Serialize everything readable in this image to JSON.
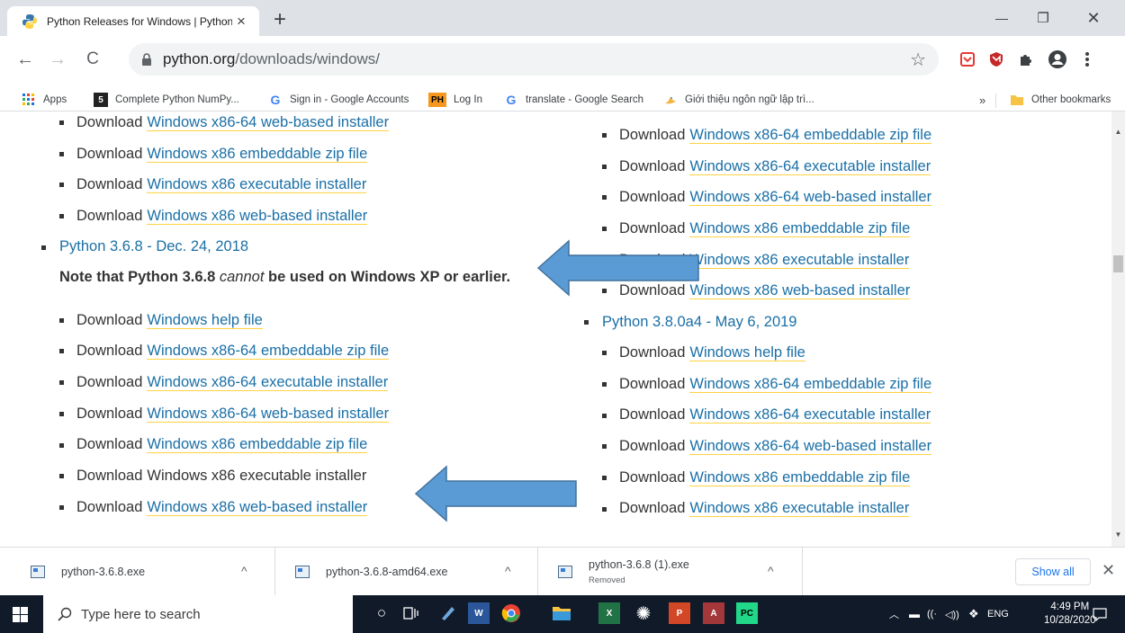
{
  "tab": {
    "title": "Python Releases for Windows | Python.org",
    "close": "×",
    "new_tab": "+"
  },
  "window": {
    "minimize": "—",
    "restore": "❐",
    "close": "✕"
  },
  "toolbar": {
    "back": "←",
    "forward": "→",
    "reload": "C",
    "url_host": "python.org",
    "url_path": "/downloads/windows/",
    "star": "☆"
  },
  "bookmarks": {
    "items": [
      {
        "label": "Apps",
        "icon": "apps-grid-icon"
      },
      {
        "label": "Complete Python NumPy...",
        "icon": "html5-icon"
      },
      {
        "label": "Sign in - Google Accounts",
        "icon": "google-icon"
      },
      {
        "label": "Log In",
        "icon": "ph-icon"
      },
      {
        "label": "translate - Google Search",
        "icon": "google-icon"
      },
      {
        "label": "Giới thiệu ngôn ngữ lập trì...",
        "icon": "bird-icon"
      }
    ],
    "overflow": "»",
    "other": "Other bookmarks"
  },
  "left": {
    "top_items": [
      {
        "prefix": "Download",
        "link": "Windows x86-64 web-based installer"
      },
      {
        "prefix": "Download",
        "link": "Windows x86 embeddable zip file"
      },
      {
        "prefix": "Download",
        "link": "Windows x86 executable installer"
      },
      {
        "prefix": "Download",
        "link": "Windows x86 web-based installer"
      }
    ],
    "release": "Python 3.6.8 - Dec. 24, 2018",
    "note_a": "Note that Python 3.6.8",
    "note_em": "cannot",
    "note_b": "be used on Windows XP or earlier.",
    "items": [
      {
        "prefix": "Download",
        "link": "Windows help file"
      },
      {
        "prefix": "Download",
        "link": "Windows x86-64 embeddable zip file"
      },
      {
        "prefix": "Download",
        "link": "Windows x86-64 executable installer"
      },
      {
        "prefix": "Download",
        "link": "Windows x86-64 web-based installer"
      },
      {
        "prefix": "Download",
        "link": "Windows x86 embeddable zip file"
      },
      {
        "prefix": "Download",
        "plain": "Windows x86 executable installer"
      },
      {
        "prefix": "Download",
        "link": "Windows x86 web-based installer"
      }
    ]
  },
  "right": {
    "top_items": [
      {
        "prefix": "Download",
        "link": "Windows x86-64 embeddable zip file"
      },
      {
        "prefix": "Download",
        "link": "Windows x86-64 executable installer"
      },
      {
        "prefix": "Download",
        "link": "Windows x86-64 web-based installer"
      },
      {
        "prefix": "Download",
        "link": "Windows x86 embeddable zip file"
      },
      {
        "prefix": "Download",
        "link": "Windows x86 executable installer"
      },
      {
        "prefix": "Download",
        "link": "Windows x86 web-based installer"
      }
    ],
    "release": "Python 3.8.0a4 - May 6, 2019",
    "items": [
      {
        "prefix": "Download",
        "link": "Windows help file"
      },
      {
        "prefix": "Download",
        "link": "Windows x86-64 embeddable zip file"
      },
      {
        "prefix": "Download",
        "link": "Windows x86-64 executable installer"
      },
      {
        "prefix": "Download",
        "link": "Windows x86-64 web-based installer"
      },
      {
        "prefix": "Download",
        "link": "Windows x86 embeddable zip file"
      },
      {
        "prefix": "Download",
        "link": "Windows x86 executable installer"
      }
    ]
  },
  "downloads": {
    "items": [
      {
        "name": "python-3.6.8.exe",
        "status": ""
      },
      {
        "name": "python-3.6.8-amd64.exe",
        "status": ""
      },
      {
        "name": "python-3.6.8 (1).exe",
        "status": "Removed"
      }
    ],
    "chevron": "^",
    "show_all": "Show all",
    "close": "✕"
  },
  "taskbar": {
    "search_placeholder": "Type here to search",
    "lang": "ENG",
    "time": "4:49 PM",
    "date": "10/28/2020"
  },
  "colors": {
    "link": "#1a6fa6",
    "link_underline": "#ffd343",
    "arrow_fill": "#5b9bd5",
    "arrow_stroke": "#41719c"
  }
}
